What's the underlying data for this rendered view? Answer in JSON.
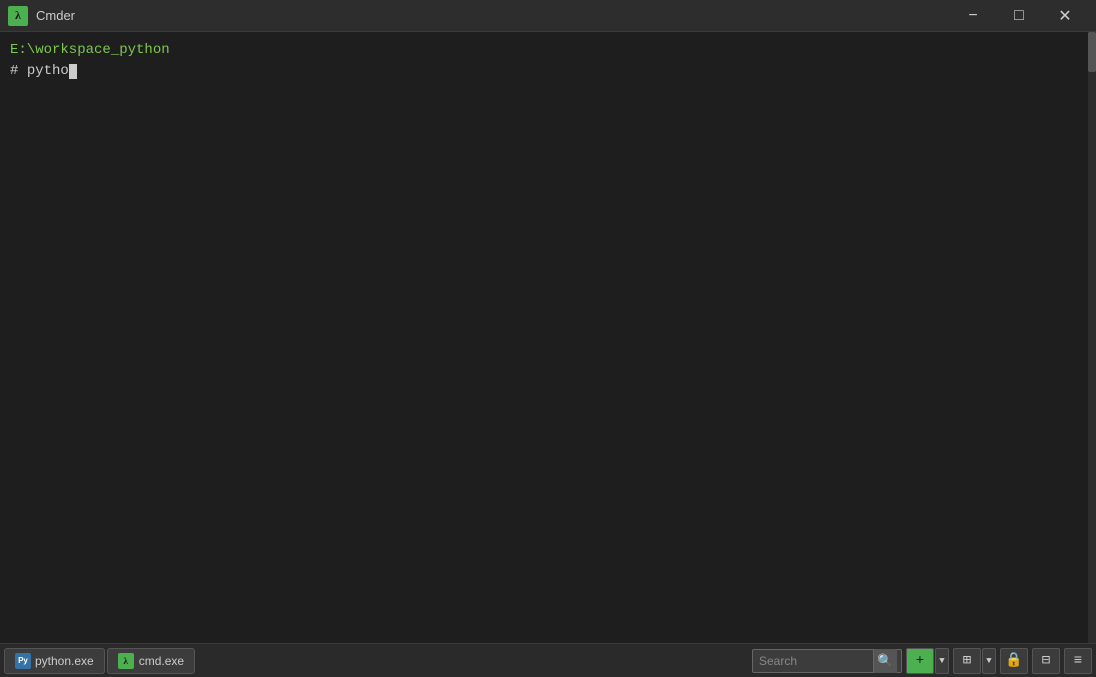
{
  "window": {
    "title": "Cmder",
    "icon_label": "λ"
  },
  "titlebar": {
    "minimize_label": "−",
    "restore_label": "□",
    "close_label": "✕"
  },
  "terminal": {
    "path_line": "E:\\workspace_python",
    "prompt_symbol": "#",
    "command_text": " pytho",
    "cursor_visible": true
  },
  "taskbar": {
    "tabs": [
      {
        "id": "python-exe",
        "icon_type": "python",
        "label": "python.exe"
      },
      {
        "id": "cmd-exe",
        "icon_type": "cmder",
        "label": "cmd.exe"
      }
    ],
    "search_placeholder": "Search",
    "buttons": {
      "add_label": "+",
      "monitor_label": "⊞",
      "lock_label": "🔒",
      "layout_label": "⊟",
      "menu_label": "≡"
    }
  }
}
